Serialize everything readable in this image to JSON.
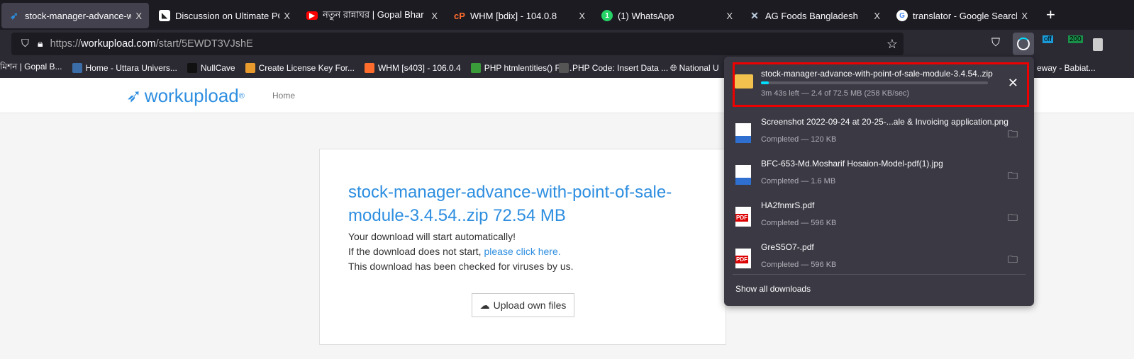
{
  "browser": {
    "tabs": [
      {
        "title": "stock-manager-advance-with",
        "active": true,
        "icon": "workupload-icon"
      },
      {
        "title": "Discussion on Ultimate POS -",
        "icon": "codecanyon-icon"
      },
      {
        "title": "নতুন রান্নাঘর | Gopal Bhar | Do",
        "icon": "youtube-icon"
      },
      {
        "title": "WHM [bdix] - 104.0.8",
        "icon": "cpanel-icon"
      },
      {
        "title": "(1) WhatsApp",
        "icon": "whatsapp-icon"
      },
      {
        "title": "AG Foods Bangladesh",
        "icon": "fork-knife-icon"
      },
      {
        "title": "translator - Google Search",
        "icon": "google-icon"
      }
    ],
    "close_glyph": "X",
    "new_tab": "+",
    "url": {
      "scheme": "https://",
      "host": "workupload.com",
      "path": "/start/5EWDT3VJshE"
    },
    "extensions": [
      {
        "badge": "off",
        "color": "#1a9bd7"
      },
      {
        "badge": "200",
        "color": "#1a8f4a"
      }
    ],
    "bookmarks": [
      {
        "label": "মিশন | Gopal B...",
        "color": "transparent"
      },
      {
        "label": "Home - Uttara Univers...",
        "color": "#3b6ea8"
      },
      {
        "label": "NullCave",
        "color": "#222"
      },
      {
        "label": "Create License Key For...",
        "color": "#e89a2c"
      },
      {
        "label": "WHM [s403] - 106.0.4",
        "color": "#ff6c2c"
      },
      {
        "label": "PHP htmlentities() Fu...",
        "color": "#3a9b3a"
      },
      {
        "label": "PHP Code: Insert Data ...",
        "color": "#555"
      },
      {
        "label": "National U",
        "color": "transparent"
      },
      {
        "label": "eway - Babiat...",
        "color": "transparent"
      }
    ]
  },
  "page": {
    "logo": "workupload",
    "logo_mark": "®",
    "nav_home": "Home",
    "file_title": "stock-manager-advance-with-point-of-sale-module-3.4.54..zip 72.54 MB",
    "line1": "Your download will start automatically!",
    "line2_prefix": "If the download does not start, ",
    "line2_link": "please click here.",
    "line3": "This download has been checked for viruses by us.",
    "upload_button": "Upload own files"
  },
  "downloads": {
    "items": [
      {
        "name": "stock-manager-advance-with-point-of-sale-module-3.4.54..zip",
        "status": "3m 43s left — 2.4 of 72.5 MB (258 KB/sec)",
        "progress_percent": 3.3,
        "type": "zip",
        "action": "cancel"
      },
      {
        "name": "Screenshot 2022-09-24 at 20-25-...ale & Invoicing application.png",
        "status": "Completed — 120 KB",
        "type": "image",
        "action": "folder"
      },
      {
        "name": "BFC-653-Md.Mosharif Hosaion-Model-pdf(1).jpg",
        "status": "Completed — 1.6 MB",
        "type": "image",
        "action": "folder"
      },
      {
        "name": "HA2fnmrS.pdf",
        "status": "Completed — 596 KB",
        "type": "pdf",
        "action": "folder"
      },
      {
        "name": "GreS5O7-.pdf",
        "status": "Completed — 596 KB",
        "type": "pdf",
        "action": "folder"
      }
    ],
    "show_all": "Show all downloads",
    "pdf_label": "PDF"
  }
}
